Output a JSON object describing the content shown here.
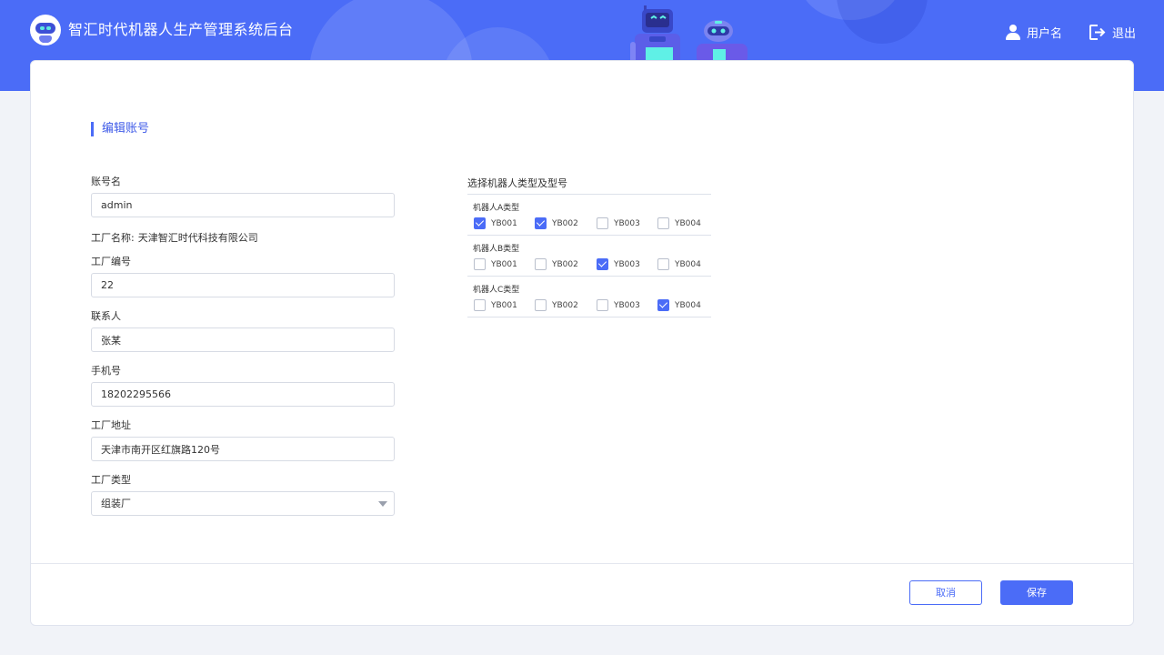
{
  "header": {
    "app_title": "智汇时代机器人生产管理系统后台",
    "username": "用户名",
    "logout": "退出"
  },
  "form": {
    "section_title": "编辑账号",
    "account_name": {
      "label": "账号名",
      "value": "admin"
    },
    "factory_name": {
      "label": "工厂名称:",
      "value": "天津智汇时代科技有限公司"
    },
    "factory_no": {
      "label": "工厂编号",
      "value": "22"
    },
    "contact": {
      "label": "联系人",
      "value": "张某"
    },
    "phone": {
      "label": "手机号",
      "value": "18202295566"
    },
    "address": {
      "label": "工厂地址",
      "value": "天津市南开区红旗路120号"
    },
    "factory_type": {
      "label": "工厂类型",
      "value": "组装厂"
    }
  },
  "robots": {
    "title": "选择机器人类型及型号",
    "groups": [
      {
        "label": "机器人A类型",
        "items": [
          {
            "name": "YB001",
            "checked": true
          },
          {
            "name": "YB002",
            "checked": true
          },
          {
            "name": "YB003",
            "checked": false
          },
          {
            "name": "YB004",
            "checked": false
          }
        ]
      },
      {
        "label": "机器人B类型",
        "items": [
          {
            "name": "YB001",
            "checked": false
          },
          {
            "name": "YB002",
            "checked": false
          },
          {
            "name": "YB003",
            "checked": true
          },
          {
            "name": "YB004",
            "checked": false
          }
        ]
      },
      {
        "label": "机器人C类型",
        "items": [
          {
            "name": "YB001",
            "checked": false
          },
          {
            "name": "YB002",
            "checked": false
          },
          {
            "name": "YB003",
            "checked": false
          },
          {
            "name": "YB004",
            "checked": true
          }
        ]
      }
    ]
  },
  "actions": {
    "cancel": "取消",
    "save": "保存"
  },
  "colors": {
    "primary": "#4b6cf7",
    "background": "#f1f3f8"
  }
}
